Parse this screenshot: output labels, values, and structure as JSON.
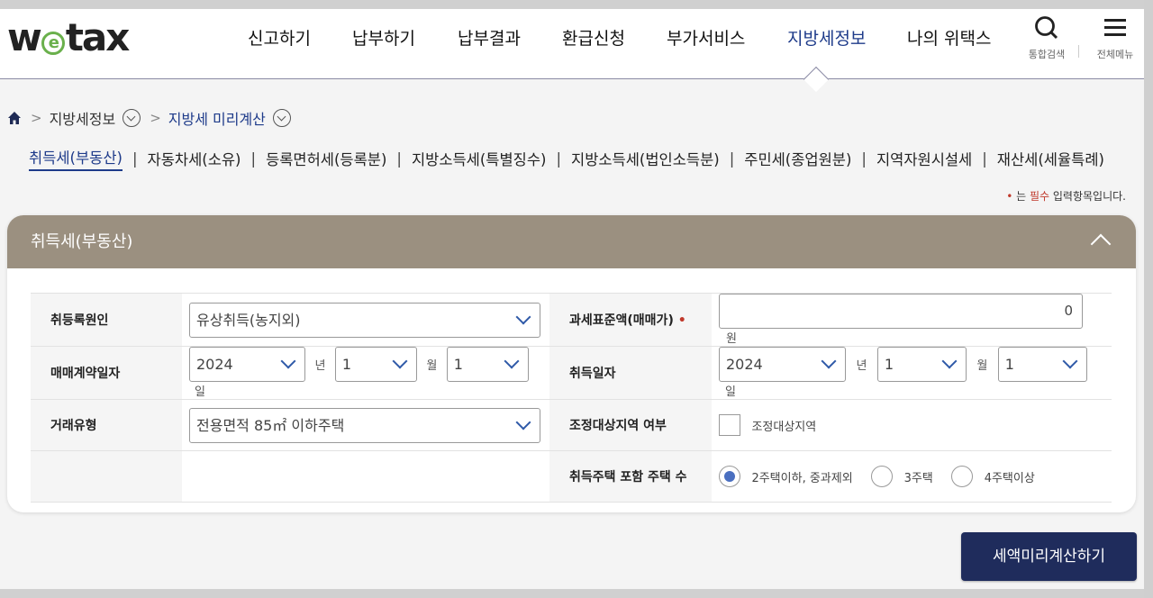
{
  "header": {
    "logo": {
      "w": "w",
      "e": "e",
      "rest": "tax"
    },
    "nav": [
      "신고하기",
      "납부하기",
      "납부결과",
      "환급신청",
      "부가서비스",
      "지방세정보",
      "나의 위택스"
    ],
    "active_nav": "지방세정보",
    "tools": {
      "search_label": "통합검색",
      "menu_label": "전체메뉴"
    }
  },
  "breadcrumb": {
    "level1": "지방세정보",
    "level2": "지방세 미리계산"
  },
  "subtabs": [
    "취득세(부동산)",
    "자동차세(소유)",
    "등록면허세(등록분)",
    "지방소득세(특별징수)",
    "지방소득세(법인소득분)",
    "주민세(종업원분)",
    "지역자원시설세",
    "재산세(세율특례)"
  ],
  "required_note": {
    "dot": "•",
    "prefix": " 는 ",
    "bold": "필수",
    "suffix": " 입력항목입니다."
  },
  "panel": {
    "title": "취득세(부동산)",
    "rows": {
      "cause_label": "취등록원인",
      "cause_value": "유상취득(농지외)",
      "base_label": "과세표준액(매매가)",
      "base_required": "•",
      "base_value": "0",
      "base_unit": "원",
      "contract_label": "매매계약일자",
      "contract_year": "2024",
      "contract_month": "1",
      "contract_day": "1",
      "acq_label": "취득일자",
      "acq_year": "2024",
      "acq_month": "1",
      "acq_day": "1",
      "unit_year": "년",
      "unit_month": "월",
      "unit_day": "일",
      "deal_label": "거래유형",
      "deal_value": "전용면적 85㎡ 이하주택",
      "adjust_label": "조정대상지역 여부",
      "adjust_check_label": "조정대상지역",
      "adjust_checked": false,
      "houses_label": "취득주택 포함 주택 수",
      "houses_options": [
        "2주택이하, 중과제외",
        "3주택",
        "4주택이상"
      ],
      "houses_selected": 0
    }
  },
  "calc_button": "세액미리계산하기",
  "colors": {
    "accent": "#1e3b8a",
    "panel_head": "#9b9080",
    "button": "#1f2c5c",
    "required": "#c0392b"
  }
}
